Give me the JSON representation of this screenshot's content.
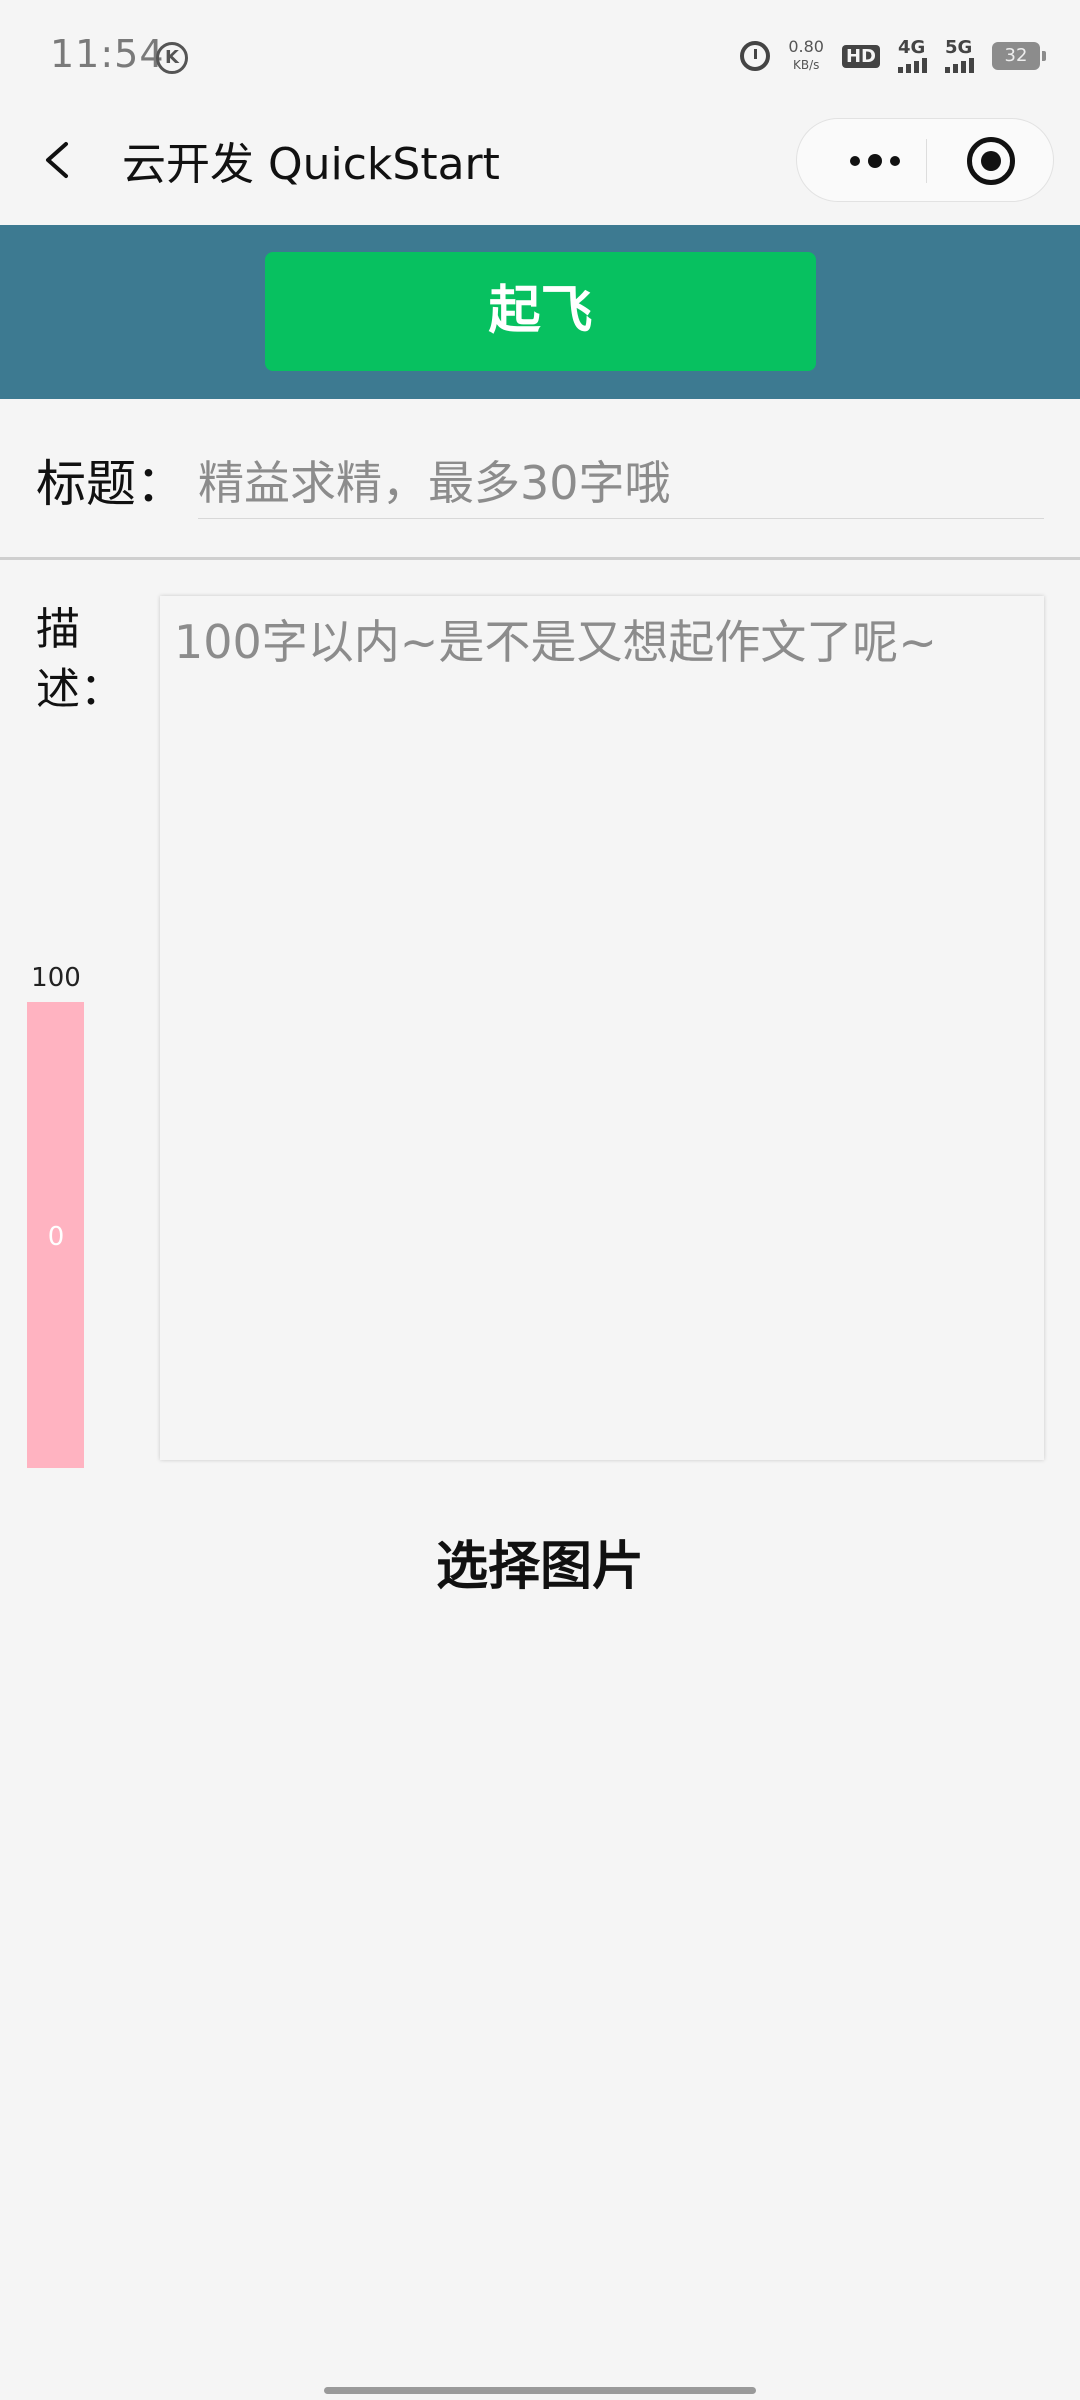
{
  "status_bar": {
    "time": "11:54",
    "k_badge": "K",
    "net_speed_value": "0.80",
    "net_speed_unit": "KB/s",
    "hd_label": "HD",
    "sim1_label": "4G",
    "sim2_label": "5G",
    "battery": "32"
  },
  "nav": {
    "title": "云开发 QuickStart"
  },
  "banner": {
    "takeoff_label": "起飞",
    "color": "#3d7a91",
    "button_color": "#07c160"
  },
  "form": {
    "title_label": "标题：",
    "title_placeholder": "精益求精，最多30字哦",
    "desc_label": "描述：",
    "desc_placeholder": "100字以内~是不是又想起作文了呢~",
    "counter_max": "100",
    "counter_current": "0",
    "counter_fill_fraction": 0
  },
  "actions": {
    "choose_image_label": "选择图片"
  }
}
